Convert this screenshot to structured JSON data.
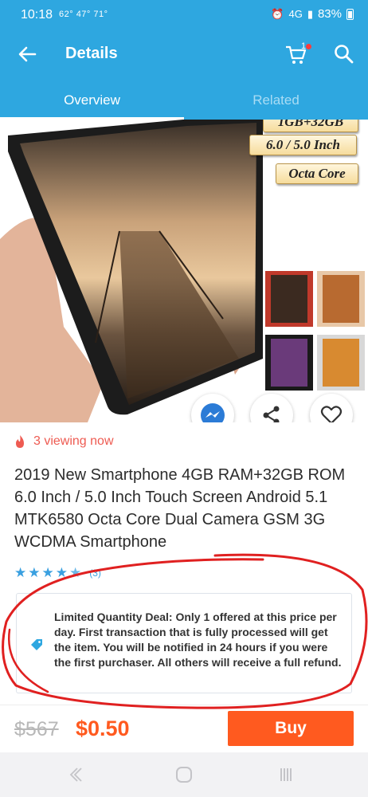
{
  "status_bar": {
    "time": "10:18",
    "extra": "62° 47° 71°",
    "battery": "83%",
    "icons": [
      "alarm-icon",
      "lte-icon",
      "signal-icon",
      "battery-icon"
    ]
  },
  "app_bar": {
    "title": "Details",
    "cart_count": "1",
    "icons": [
      "back-arrow-icon",
      "cart-icon",
      "search-icon"
    ]
  },
  "tabs": [
    {
      "label": "Overview",
      "active": true
    },
    {
      "label": "Related",
      "active": false
    }
  ],
  "hero": {
    "spec_tags": [
      "1GB+32GB",
      "6.0 / 5.0 Inch",
      "Octa Core"
    ],
    "share_icons": [
      "messenger-icon",
      "share-icon",
      "heart-icon"
    ]
  },
  "product": {
    "viewing": "3 viewing now",
    "title": "2019 New Smartphone 4GB RAM+32GB ROM 6.0 Inch / 5.0 Inch Touch Screen Android 5.1 MTK6580 Octa Core Dual Camera GSM 3G WCDMA Smartphone",
    "rating_stars": 4.5,
    "rating_count": "(3)"
  },
  "deal": {
    "text": "Limited Quantity Deal: Only 1 offered at this price per day. First transaction that is fully processed will get the item. You will be notified in 24 hours if you were the first purchaser. All others will receive a full refund."
  },
  "purchase": {
    "old_price": "$567",
    "new_price": "$0.50",
    "buy_label": "Buy"
  },
  "colors": {
    "brand": "#2ea7e0",
    "accent": "#ff5a1f",
    "viewing": "#ee5b52",
    "annotation": "#e02020"
  }
}
